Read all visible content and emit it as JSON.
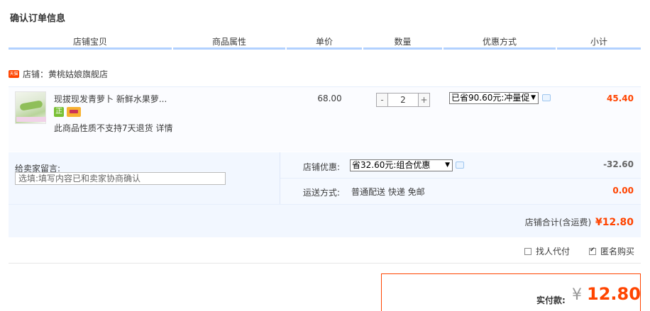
{
  "page_title": "确认订单信息",
  "columns": [
    "店铺宝贝",
    "商品属性",
    "单价",
    "数量",
    "优惠方式",
    "小计"
  ],
  "shop": {
    "badge": "天猫",
    "label": "店铺：黄桃姑娘旗舰店"
  },
  "item": {
    "title": "现拔现发青萝卜 新鲜水果萝...",
    "note": "此商品性质不支持7天退货 详情",
    "unit_price": "68.00",
    "qty_minus": "-",
    "quantity": "2",
    "qty_plus": "+",
    "promo_selected": "已省90.60元:冲量促",
    "subtotal": "45.40",
    "service_icon": "zheng-icon"
  },
  "message": {
    "label": "给卖家留言:",
    "placeholder": "选填:填写内容已和卖家协商确认"
  },
  "shop_discount": {
    "label": "店铺优惠:",
    "selected": "省32.60元:组合优惠",
    "value": "-32.60"
  },
  "shipping": {
    "label": "运送方式:",
    "text": "普通配送 快递 免邮",
    "value": "0.00"
  },
  "shop_total": {
    "label": "店铺合计(含运费)",
    "amount": "¥12.80"
  },
  "options": {
    "proxy_pay": "找人代付",
    "anonymous": "匿名购买"
  },
  "payment": {
    "label": "实付款:",
    "currency": "¥",
    "amount": "12.80"
  },
  "colors": {
    "accent": "#ff4400",
    "header_line": "#b2d1ff",
    "block_bg": "#f2f7ff"
  }
}
